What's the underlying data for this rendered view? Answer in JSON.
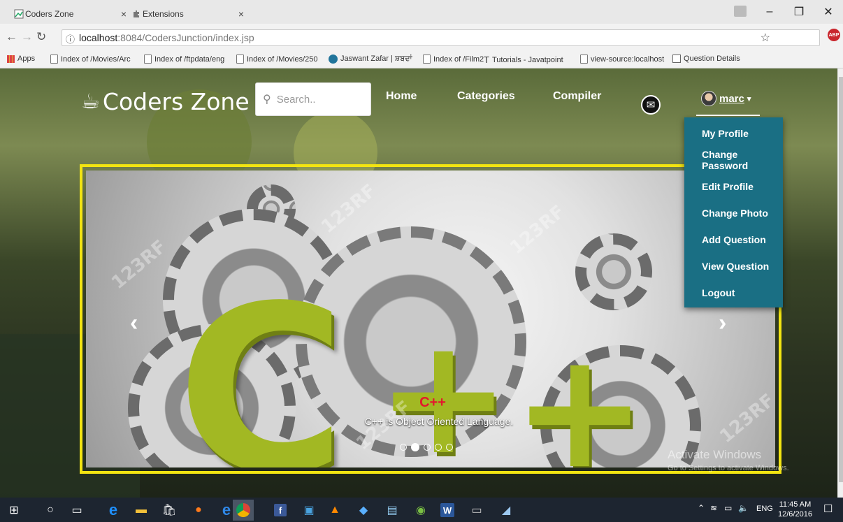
{
  "browser": {
    "tabs": [
      {
        "title": "Coders Zone"
      },
      {
        "title": "Extensions"
      }
    ],
    "url_host": "localhost",
    "url_path": ":8084/CodersJunction/index.jsp",
    "bookmarks": [
      {
        "label": "Apps"
      },
      {
        "label": "Index of /Movies/Arc"
      },
      {
        "label": "Index of /ftpdata/eng"
      },
      {
        "label": "Index of /Movies/250"
      },
      {
        "label": "Jaswant Zafar | ਸ਼ਬਦਾਂ"
      },
      {
        "label": "Index of /Film2"
      },
      {
        "label": "Tutorials - Javatpoint"
      },
      {
        "label": "view-source:localhost"
      },
      {
        "label": "Question Details"
      }
    ]
  },
  "site": {
    "logo": "Coders Zone",
    "search_placeholder": "Search..",
    "nav": {
      "home": "Home",
      "categories": "Categories",
      "compiler": "Compiler"
    },
    "user": {
      "name": "marc",
      "caret": "▾"
    },
    "dropdown": [
      {
        "label": "My Profile"
      },
      {
        "label": "Change Password"
      },
      {
        "label": "Edit Profile"
      },
      {
        "label": "Change Photo"
      },
      {
        "label": "Add Question"
      },
      {
        "label": "View Question"
      },
      {
        "label": "Logout"
      }
    ]
  },
  "carousel": {
    "caption_title": "C++",
    "caption_text": "C++ is Object Oriented Language.",
    "slide_count": 5,
    "active_slide": 2,
    "border_color": "#f2e411"
  },
  "activate": {
    "title": "Activate Windows",
    "subtitle": "Go to Settings to activate Windows."
  },
  "taskbar": {
    "lang": "ENG",
    "time": "11:45 AM",
    "date": "12/6/2016"
  },
  "colors": {
    "dropdown_bg": "#1a6f84",
    "accent_green": "#a2b823"
  }
}
